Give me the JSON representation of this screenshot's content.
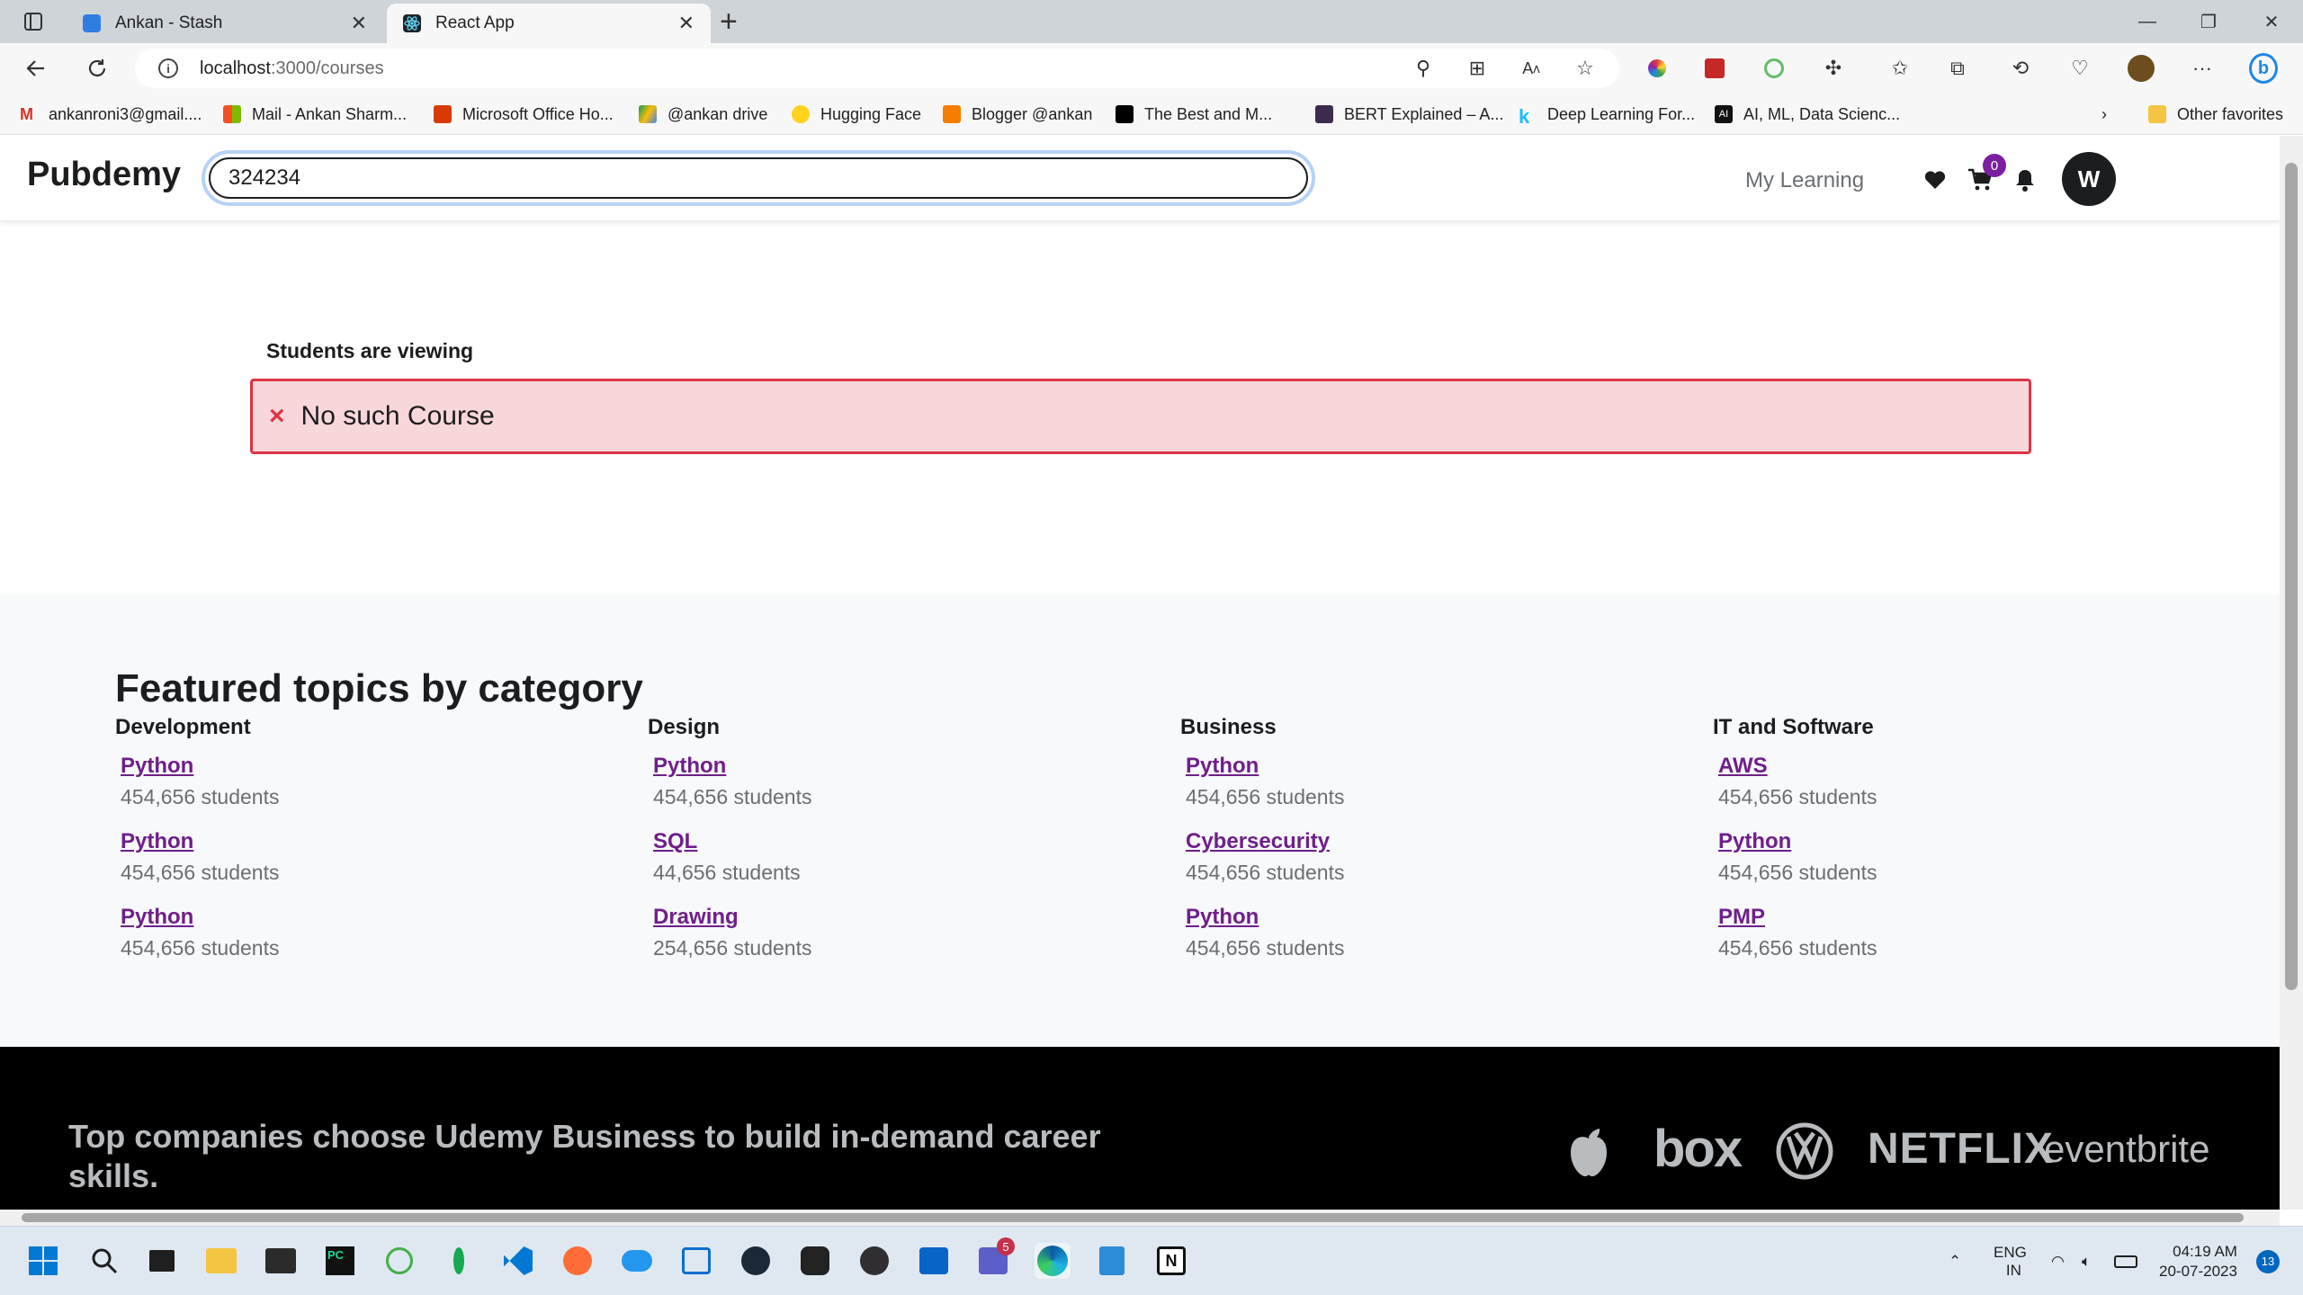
{
  "browser": {
    "tabs": [
      {
        "title": "Ankan - Stash",
        "active": false
      },
      {
        "title": "React App",
        "active": true
      }
    ],
    "url_host": "localhost",
    "url_path": ":3000/courses",
    "bookmarks": [
      "ankanroni3@gmail....",
      "Mail - Ankan Sharm...",
      "Microsoft Office Ho...",
      "@ankan drive",
      "Hugging Face",
      "Blogger @ankan",
      "The Best and M...",
      "BERT Explained – A...",
      "Deep Learning For...",
      "AI, ML, Data Scienc...",
      "Other favorites"
    ]
  },
  "header": {
    "logo": "Pubdemy",
    "search_value": "324234",
    "my_learning": "My Learning",
    "cart_count": "0",
    "avatar_initial": "W"
  },
  "viewing": {
    "heading": "Students are viewing",
    "alert_icon": "×",
    "alert_message": "No such Course"
  },
  "featured": {
    "title": "Featured topics by category",
    "columns": [
      {
        "heading": "Development",
        "topics": [
          {
            "name": "Python",
            "students": "454,656 students"
          },
          {
            "name": "Python",
            "students": "454,656 students"
          },
          {
            "name": "Python",
            "students": "454,656 students"
          }
        ]
      },
      {
        "heading": "Design",
        "topics": [
          {
            "name": "Python",
            "students": "454,656 students"
          },
          {
            "name": "SQL",
            "students": "44,656 students"
          },
          {
            "name": "Drawing",
            "students": "254,656 students"
          }
        ]
      },
      {
        "heading": "Business",
        "topics": [
          {
            "name": "Python",
            "students": "454,656 students"
          },
          {
            "name": "Cybersecurity",
            "students": "454,656 students"
          },
          {
            "name": "Python",
            "students": "454,656 students"
          }
        ]
      },
      {
        "heading": "IT and Software",
        "topics": [
          {
            "name": "AWS",
            "students": "454,656 students"
          },
          {
            "name": "Python",
            "students": "454,656 students"
          },
          {
            "name": "PMP",
            "students": "454,656 students"
          }
        ]
      }
    ]
  },
  "companies": {
    "text": "Top companies choose Udemy Business to build in-demand career skills.",
    "brands": [
      "box",
      "NETFLIX",
      "eventbrite"
    ]
  },
  "taskbar": {
    "lang_top": "ENG",
    "lang_bottom": "IN",
    "time": "04:19 AM",
    "date": "20-07-2023",
    "notifications": "13",
    "teams_badge": "5"
  }
}
